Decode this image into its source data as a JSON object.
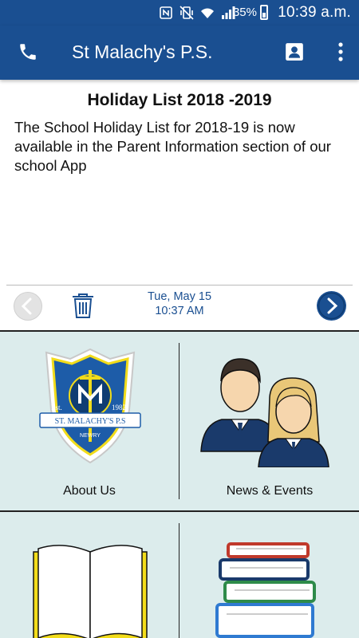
{
  "status_bar": {
    "battery_percent": "35%",
    "time": "10:39 a.m.",
    "icons": [
      "nfc-icon",
      "vibrate-icon",
      "wifi-icon",
      "signal-icon",
      "battery-icon"
    ]
  },
  "app_bar": {
    "title": "St Malachy's P.S.",
    "left_icon": "phone-icon",
    "right_icons": [
      "contact-icon",
      "more-vert-icon"
    ]
  },
  "notice": {
    "title": "Holiday List 2018 -2019",
    "body": "The School Holiday List for 2018-19 is now available in the Parent Information section of our school App"
  },
  "navigation": {
    "date": "Tue, May 15",
    "time": "10:37 AM"
  },
  "tiles": [
    {
      "label": "About Us",
      "icon": "school-crest-icon"
    },
    {
      "label": "News & Events",
      "icon": "students-icon"
    },
    {
      "label": "",
      "icon": "open-book-icon"
    },
    {
      "label": "",
      "icon": "book-stack-icon"
    }
  ],
  "crest": {
    "est": "Est.",
    "year": "1982",
    "name": "ST. MALACHY'S P.S",
    "town": "NEWRY"
  },
  "colors": {
    "primary": "#1a4f91",
    "tile_bg": "#dcecec",
    "crest_yellow": "#f2dc1a"
  }
}
